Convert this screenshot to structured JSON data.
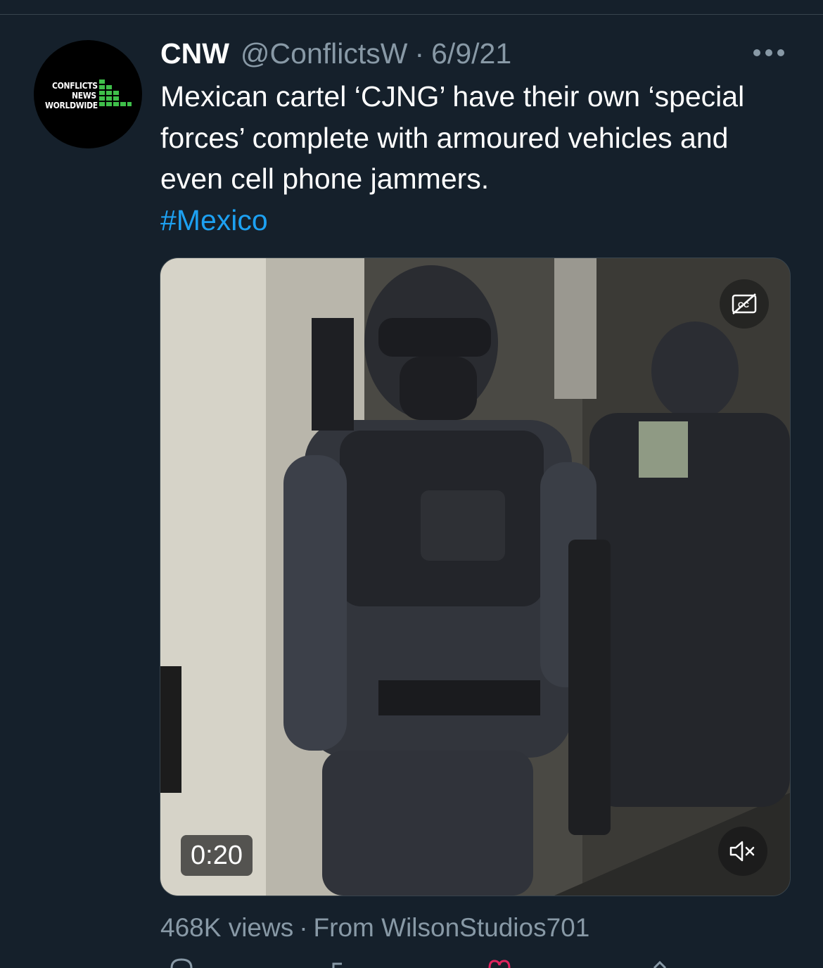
{
  "tweet": {
    "avatar_logo": [
      "CONFLICTS",
      "NEWS",
      "WORLDWIDE"
    ],
    "display_name": "CNW",
    "handle": "@ConflictsW",
    "separator": "·",
    "date": "6/9/21",
    "more_icon": "more-horizontal-icon",
    "text": "Mexican cartel ‘CJNG’ have their own ‘special forces’ complete with armoured vehicles and even cell phone jammers.",
    "hashtag": "#Mexico"
  },
  "video": {
    "duration": "0:20",
    "cc_icon": "closed-captions-off-icon",
    "mute_icon": "volume-muted-icon"
  },
  "stats": {
    "views": "468K views",
    "separator": "·",
    "source": "From WilsonStudios701"
  },
  "actions": [
    "reply-icon",
    "retweet-icon",
    "like-icon",
    "share-icon"
  ],
  "colors": {
    "background": "#15202b",
    "text_primary": "#ffffff",
    "text_secondary": "#8899a6",
    "link": "#1da1f2",
    "like_accent": "#e0245e",
    "logo_green": "#3fbf4a"
  }
}
